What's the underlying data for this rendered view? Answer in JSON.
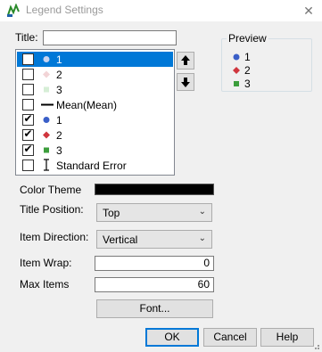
{
  "window": {
    "title": "Legend Settings",
    "close": "✕"
  },
  "title_field": {
    "label": "Title:",
    "value": ""
  },
  "list": {
    "items": [
      {
        "label": "1",
        "checked": false,
        "selected": true,
        "marker": "circle-faded-icon"
      },
      {
        "label": "2",
        "checked": false,
        "selected": false,
        "marker": "diamond-faded-icon"
      },
      {
        "label": "3",
        "checked": false,
        "selected": false,
        "marker": "square-faded-icon"
      },
      {
        "label": "Mean(Mean)",
        "checked": false,
        "selected": false,
        "marker": "line-icon"
      },
      {
        "label": "1",
        "checked": true,
        "selected": false,
        "marker": "circle-blue-icon"
      },
      {
        "label": "2",
        "checked": true,
        "selected": false,
        "marker": "diamond-red-icon"
      },
      {
        "label": "3",
        "checked": true,
        "selected": false,
        "marker": "square-green-icon"
      },
      {
        "label": "Standard Error",
        "checked": false,
        "selected": false,
        "marker": "error-bar-icon"
      }
    ]
  },
  "preview": {
    "title": "Preview",
    "items": [
      {
        "label": "1",
        "marker": "circle-blue-icon",
        "color": "#3a5fc8"
      },
      {
        "label": "2",
        "marker": "diamond-red-icon",
        "color": "#d0363e"
      },
      {
        "label": "3",
        "marker": "square-green-icon",
        "color": "#3c9e3c"
      }
    ]
  },
  "color_theme": {
    "label": "Color Theme",
    "swatch_color": "#000000"
  },
  "title_position": {
    "label": "Title Position:",
    "value": "Top"
  },
  "item_direction": {
    "label": "Item Direction:",
    "value": "Vertical"
  },
  "item_wrap": {
    "label": "Item Wrap:",
    "value": "0"
  },
  "max_items": {
    "label": "Max Items",
    "value": "60"
  },
  "buttons": {
    "font": "Font...",
    "ok": "OK",
    "cancel": "Cancel",
    "help": "Help"
  },
  "colors": {
    "selection": "#0078d7",
    "blue": "#3a5fc8",
    "red": "#d0363e",
    "green": "#3c9e3c"
  }
}
